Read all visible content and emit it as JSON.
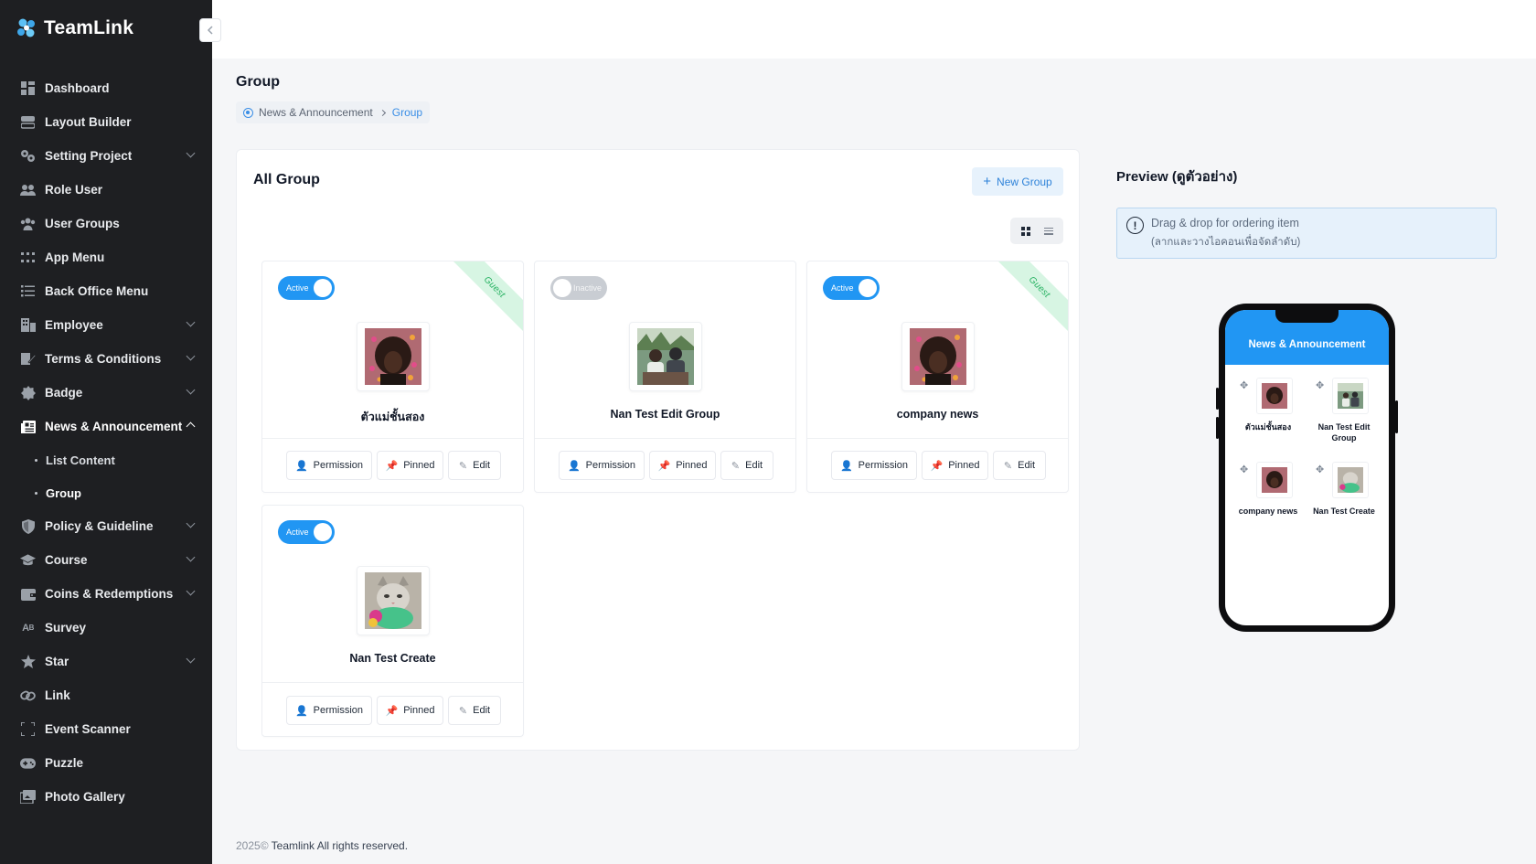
{
  "brand": {
    "name": "TeamLink"
  },
  "sidebar": {
    "items": [
      {
        "label": "Dashboard",
        "icon": "dashboard-icon",
        "has_children": false
      },
      {
        "label": "Layout Builder",
        "icon": "layout-icon",
        "has_children": false
      },
      {
        "label": "Setting Project",
        "icon": "gears-icon",
        "has_children": true
      },
      {
        "label": "Role User",
        "icon": "users-icon",
        "has_children": false
      },
      {
        "label": "User Groups",
        "icon": "user-group-icon",
        "has_children": false
      },
      {
        "label": "App Menu",
        "icon": "grid-dots-icon",
        "has_children": false
      },
      {
        "label": "Back Office Menu",
        "icon": "list-icon",
        "has_children": false
      },
      {
        "label": "Employee",
        "icon": "building-icon",
        "has_children": true
      },
      {
        "label": "Terms & Conditions",
        "icon": "pen-doc-icon",
        "has_children": true
      },
      {
        "label": "Badge",
        "icon": "badge-icon",
        "has_children": true
      },
      {
        "label": "News & Announcement",
        "icon": "newspaper-icon",
        "has_children": true,
        "expanded": true
      },
      {
        "label": "Policy & Guideline",
        "icon": "shield-icon",
        "has_children": true
      },
      {
        "label": "Course",
        "icon": "graduation-cap-icon",
        "has_children": true
      },
      {
        "label": "Coins & Redemptions",
        "icon": "wallet-icon",
        "has_children": true
      },
      {
        "label": "Survey",
        "icon": "spellcheck-icon",
        "has_children": false
      },
      {
        "label": "Star",
        "icon": "star-icon",
        "has_children": true
      },
      {
        "label": "Link",
        "icon": "link-icon",
        "has_children": false
      },
      {
        "label": "Event Scanner",
        "icon": "scan-icon",
        "has_children": false
      },
      {
        "label": "Puzzle",
        "icon": "gamepad-icon",
        "has_children": false
      },
      {
        "label": "Photo Gallery",
        "icon": "images-icon",
        "has_children": false
      }
    ],
    "sub_items": [
      {
        "label": "List Content",
        "active": false
      },
      {
        "label": "Group",
        "active": true
      }
    ]
  },
  "header": {
    "title": "Group",
    "breadcrumb": [
      "News & Announcement",
      "Group"
    ]
  },
  "main": {
    "title": "All Group",
    "new_button": "New Group",
    "view_mode": "grid",
    "cards": [
      {
        "status": "Active",
        "active": true,
        "ribbon": "Guest",
        "name": "ตัวแม่ชั้นสอง",
        "image": "portrait-image"
      },
      {
        "status": "Inactive",
        "active": false,
        "ribbon": "",
        "name": "Nan Test Edit Group",
        "image": "people-photo-image"
      },
      {
        "status": "Active",
        "active": true,
        "ribbon": "Guest",
        "name": "company news",
        "image": "portrait-image"
      },
      {
        "status": "Active",
        "active": true,
        "ribbon": "",
        "name": "Nan Test Create",
        "image": "cat-image"
      }
    ],
    "actions": {
      "permission": "Permission",
      "pinned": "Pinned",
      "edit": "Edit"
    }
  },
  "preview": {
    "title": "Preview (ดูตัวอย่าง)",
    "hint_line1": "Drag & drop for ordering item",
    "hint_line2": "(ลากและวางไอคอนเพื่อจัดลำดับ)",
    "screen_title": "News & Announcement",
    "items": [
      "ตัวแม่ชั้นสอง",
      "Nan Test Edit Group",
      "company news",
      "Nan Test Create"
    ]
  },
  "footer": {
    "year": "2025©",
    "text": "Teamlink All rights reserved."
  },
  "colors": {
    "sidebar_bg": "#1e1f22",
    "accent": "#2196f3",
    "guest_ribbon": "#d7f5e3",
    "guest_text": "#22b05e"
  }
}
